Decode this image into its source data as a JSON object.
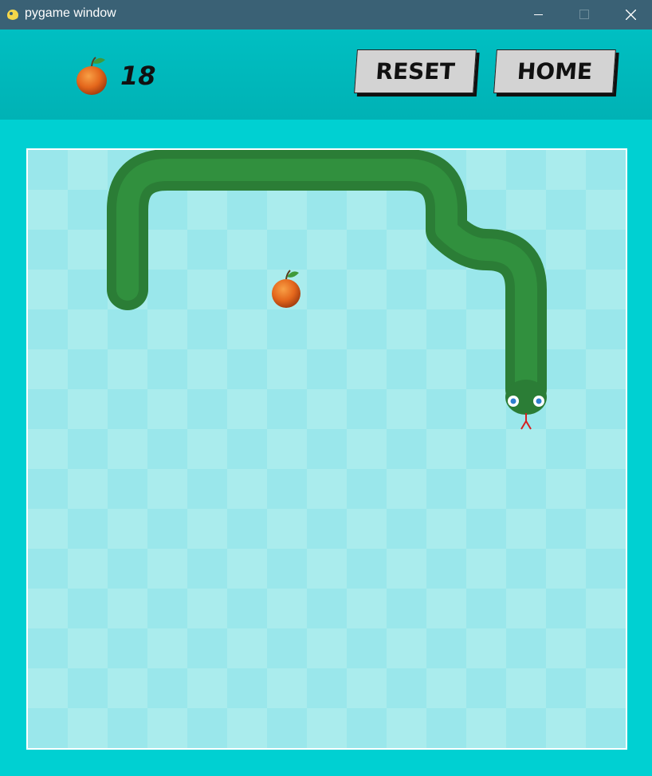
{
  "window": {
    "title": "pygame window"
  },
  "hud": {
    "score": "18"
  },
  "buttons": {
    "reset": "RESET",
    "home": "HOME"
  },
  "colors": {
    "background": "#00d0d2",
    "snake": "#2e8b3c",
    "board_light": "#aaeced",
    "board_dark": "#9ae7eb"
  },
  "icons": {
    "app": "pygame-snake-icon",
    "score": "orange-icon",
    "food": "orange-icon"
  }
}
